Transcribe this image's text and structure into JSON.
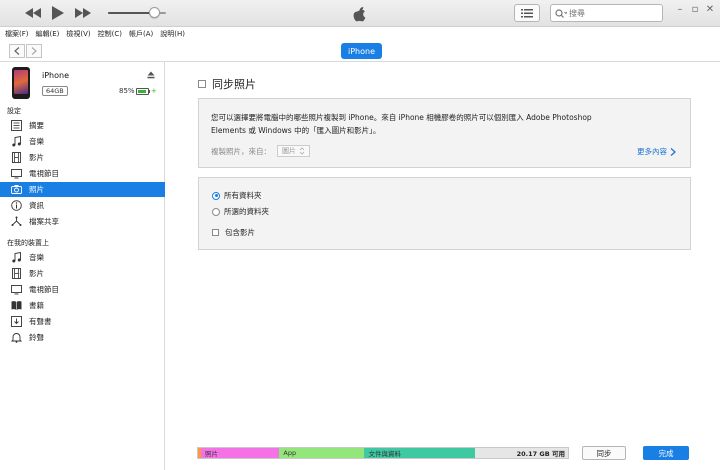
{
  "player": {
    "volume": 0.8
  },
  "search": {
    "placeholder": "搜尋"
  },
  "menu": [
    "檔案(F)",
    "編輯(E)",
    "檢視(V)",
    "控制(C)",
    "帳戶(A)",
    "說明(H)"
  ],
  "device_tab": "iPhone",
  "device": {
    "name": "iPhone",
    "capacity": "64GB",
    "battery_pct": "85%",
    "battery_level": 0.85
  },
  "sidebar": {
    "settings_heading": "設定",
    "settings_items": [
      {
        "label": "摘要",
        "icon": "summary-icon"
      },
      {
        "label": "音樂",
        "icon": "music-note-icon"
      },
      {
        "label": "影片",
        "icon": "film-icon"
      },
      {
        "label": "電視節目",
        "icon": "tv-icon"
      },
      {
        "label": "照片",
        "icon": "camera-icon",
        "active": true
      },
      {
        "label": "資訊",
        "icon": "info-icon"
      },
      {
        "label": "檔案共享",
        "icon": "file-sharing-icon"
      }
    ],
    "ondevice_heading": "在我的裝置上",
    "ondevice_items": [
      {
        "label": "音樂",
        "icon": "music-note-icon"
      },
      {
        "label": "影片",
        "icon": "film-icon"
      },
      {
        "label": "電視節目",
        "icon": "tv-icon"
      },
      {
        "label": "書籍",
        "icon": "book-icon"
      },
      {
        "label": "有聲書",
        "icon": "audiobook-icon"
      },
      {
        "label": "鈴聲",
        "icon": "bell-icon"
      }
    ]
  },
  "main": {
    "sync_label": "同步照片",
    "description_line1": "您可以選擇要將電腦中的哪些照片複製到 iPhone。來自 iPhone 相機膠卷的照片可以個別匯入 Adobe Photoshop",
    "description_line2": "Elements 或 Windows 中的「匯入圖片和影片」。",
    "copy_from_label": "複製照片，來自：",
    "copy_from_value": "圖片",
    "more_link": "更多內容",
    "options": {
      "all_folders": "所有資料夾",
      "selected_folders": "所選的資料夾",
      "include_videos": "包含影片"
    }
  },
  "storage": {
    "segments": [
      {
        "label": "照片",
        "color": "#f472e6",
        "fraction": 0.22
      },
      {
        "label": "App",
        "color": "#93e67a",
        "fraction": 0.23
      },
      {
        "label": "文件與資料",
        "color": "#3ec9a3",
        "fraction": 0.3
      }
    ],
    "free_label": "20.17 GB 可用",
    "free_fraction": 0.25,
    "photos_edge_color": "#ff9a3c"
  },
  "buttons": {
    "sync": "同步",
    "done": "完成"
  }
}
